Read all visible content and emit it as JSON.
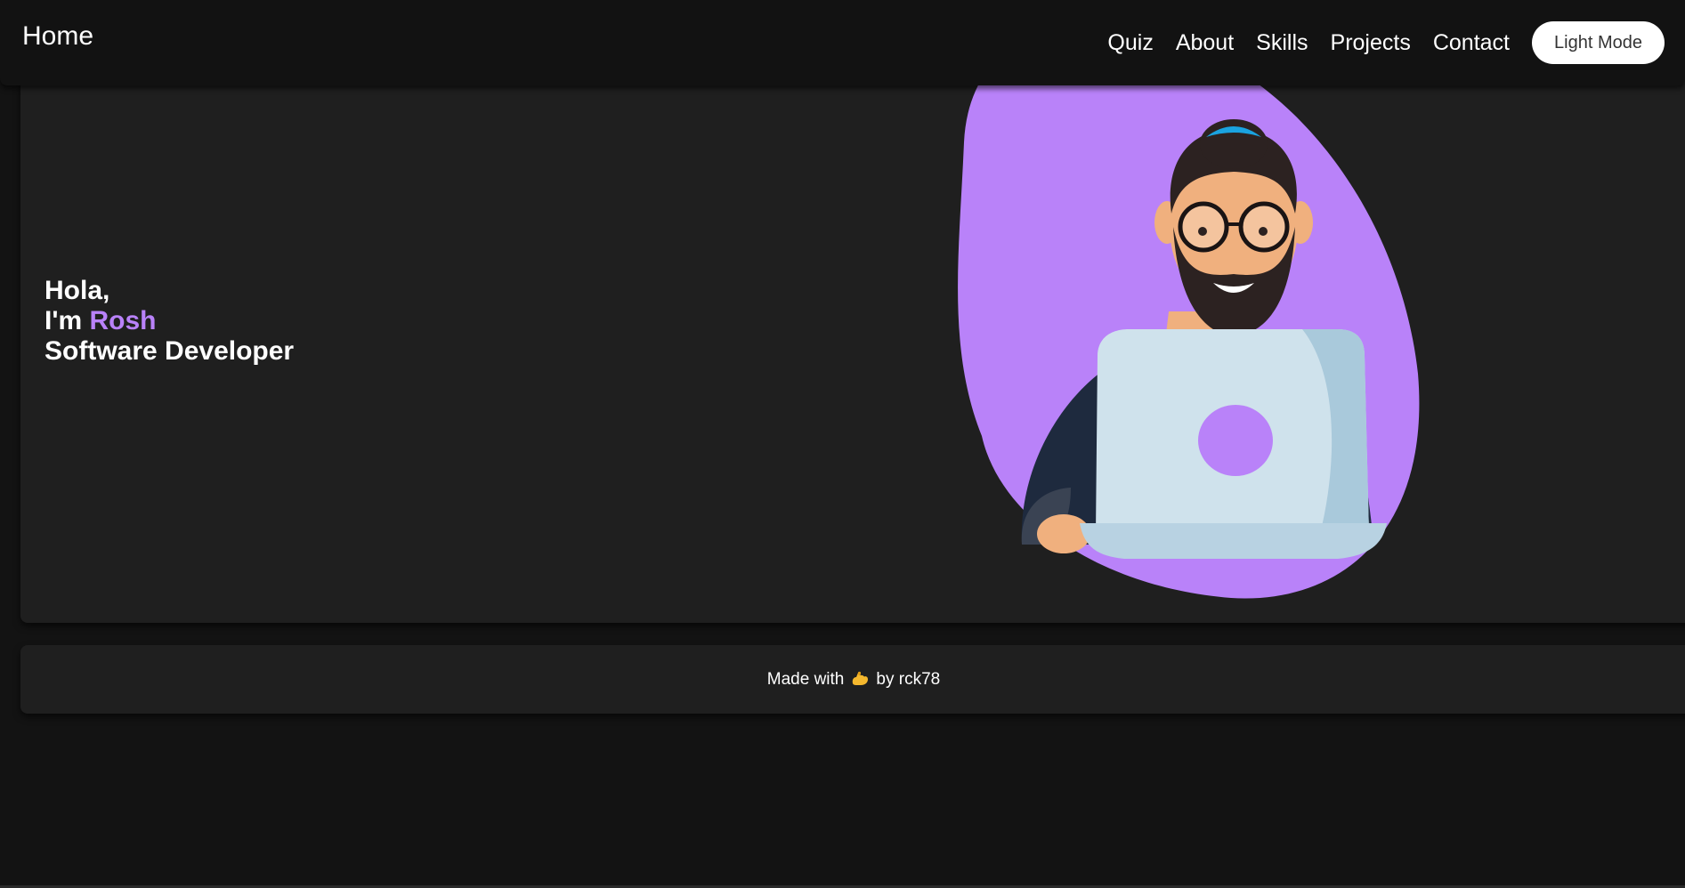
{
  "navbar": {
    "brand": "Home",
    "links": [
      "Quiz",
      "About",
      "Skills",
      "Projects",
      "Contact"
    ],
    "mode_button": "Light Mode"
  },
  "hero": {
    "greeting": "Hola,",
    "intro_prefix": "I'm ",
    "name": "Rosh",
    "role": "Software Developer",
    "illustration_icon": "developer-with-laptop-illustration"
  },
  "footer": {
    "prefix": "Made with",
    "icon": "flexed-biceps-icon",
    "suffix": "by rck78"
  },
  "colors": {
    "background": "#131313",
    "navbar": "#121212",
    "card": "#1f1f1f",
    "accent": "#b982f9",
    "text": "#ffffff"
  }
}
